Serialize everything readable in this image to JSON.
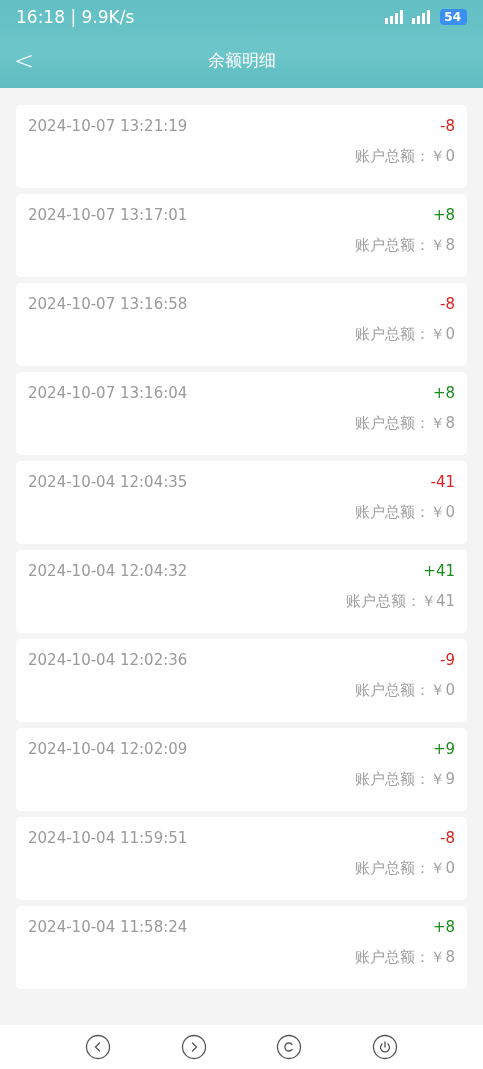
{
  "status_bar": {
    "time": "16:18 | 9.9K/s",
    "battery": "54"
  },
  "header": {
    "back": "<",
    "title": "余额明细"
  },
  "records": [
    {
      "time": "2024-10-07 13:21:19",
      "amount": "-8",
      "kind": "out",
      "balance": "账户总额：￥0"
    },
    {
      "time": "2024-10-07 13:17:01",
      "amount": "+8",
      "kind": "in",
      "balance": "账户总额：￥8"
    },
    {
      "time": "2024-10-07 13:16:58",
      "amount": "-8",
      "kind": "out",
      "balance": "账户总额：￥0"
    },
    {
      "time": "2024-10-07 13:16:04",
      "amount": "+8",
      "kind": "in",
      "balance": "账户总额：￥8"
    },
    {
      "time": "2024-10-04 12:04:35",
      "amount": "-41",
      "kind": "out",
      "balance": "账户总额：￥0"
    },
    {
      "time": "2024-10-04 12:04:32",
      "amount": "+41",
      "kind": "in",
      "balance": "账户总额：￥41"
    },
    {
      "time": "2024-10-04 12:02:36",
      "amount": "-9",
      "kind": "out",
      "balance": "账户总额：￥0"
    },
    {
      "time": "2024-10-04 12:02:09",
      "amount": "+9",
      "kind": "in",
      "balance": "账户总额：￥9"
    },
    {
      "time": "2024-10-04 11:59:51",
      "amount": "-8",
      "kind": "out",
      "balance": "账户总额：￥0"
    },
    {
      "time": "2024-10-04 11:58:24",
      "amount": "+8",
      "kind": "in",
      "balance": "账户总额：￥8"
    }
  ]
}
